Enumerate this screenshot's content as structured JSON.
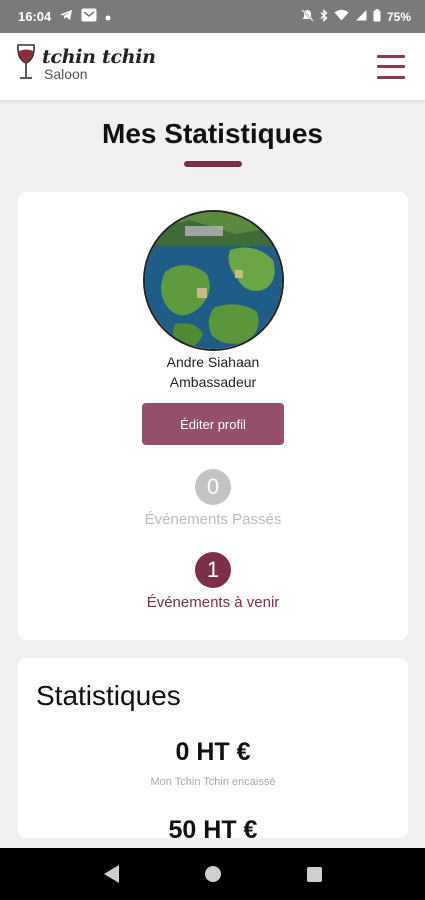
{
  "status_bar": {
    "time": "16:04",
    "battery": "75%",
    "icons_left": [
      "telegram-icon",
      "mail-icon",
      "dot-icon"
    ],
    "icons_right": [
      "mute-icon",
      "bluetooth-icon",
      "wifi-icon",
      "signal-icon",
      "battery-icon"
    ]
  },
  "header": {
    "logo_line1": "tchin tchin",
    "logo_line2": "Saloon",
    "menu_icon": "hamburger-menu-icon"
  },
  "page": {
    "title": "Mes Statistiques"
  },
  "profile": {
    "name": "Andre Siahaan",
    "role": "Ambassadeur",
    "edit_label": "Éditer profil",
    "past_count": "0",
    "past_label": "Événements Passés",
    "upcoming_count": "1",
    "upcoming_label": "Événements à venir"
  },
  "stats": {
    "title": "Statistiques",
    "value1": "0 HT €",
    "caption1": "Mon Tchin Tchin encaissé",
    "value2": "50 HT €"
  },
  "colors": {
    "accent": "#7d2e4b",
    "button": "#93506a",
    "muted": "#c4c4c4"
  }
}
